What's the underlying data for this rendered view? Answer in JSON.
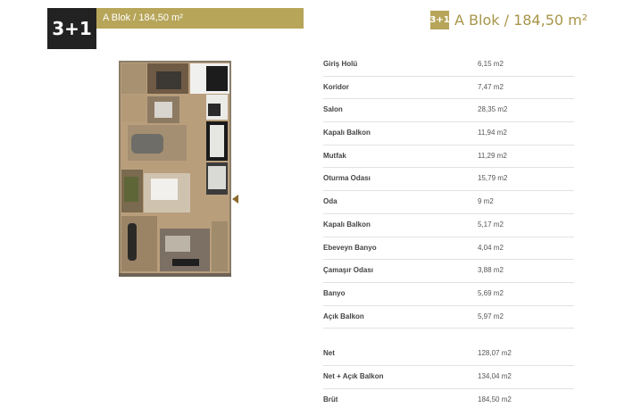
{
  "header": {
    "type_badge": "3+1",
    "bar_title": "A Blok / 184,50 m²",
    "right_badge": "3+1",
    "right_title": "A Blok / 184,50 m²"
  },
  "rooms": [
    {
      "label": "Giriş Holü",
      "value": "6,15 m2"
    },
    {
      "label": "Koridor",
      "value": "7,47 m2"
    },
    {
      "label": "Salon",
      "value": "28,35 m2"
    },
    {
      "label": "Kapalı Balkon",
      "value": "11,94 m2"
    },
    {
      "label": "Mutfak",
      "value": "11,29 m2"
    },
    {
      "label": "Oturma  Odası",
      "value": "15,79 m2"
    },
    {
      "label": "Oda",
      "value": "9 m2"
    },
    {
      "label": "Kapalı Balkon",
      "value": "5,17 m2"
    },
    {
      "label": "Ebeveyn Banyo",
      "value": "4,04 m2"
    },
    {
      "label": "Çamaşır Odası",
      "value": "3,88 m2"
    },
    {
      "label": "Banyo",
      "value": "5,69 m2"
    },
    {
      "label": "Açık Balkon",
      "value": "5,97 m2"
    }
  ],
  "totals": [
    {
      "label": "Net",
      "value": "128,07 m2"
    },
    {
      "label": "Net + Açık Balkon",
      "value": "134,04 m2"
    },
    {
      "label": "Brüt",
      "value": "184,50 m2"
    }
  ],
  "colors": {
    "gold": "#b7a559",
    "dark": "#222222"
  }
}
